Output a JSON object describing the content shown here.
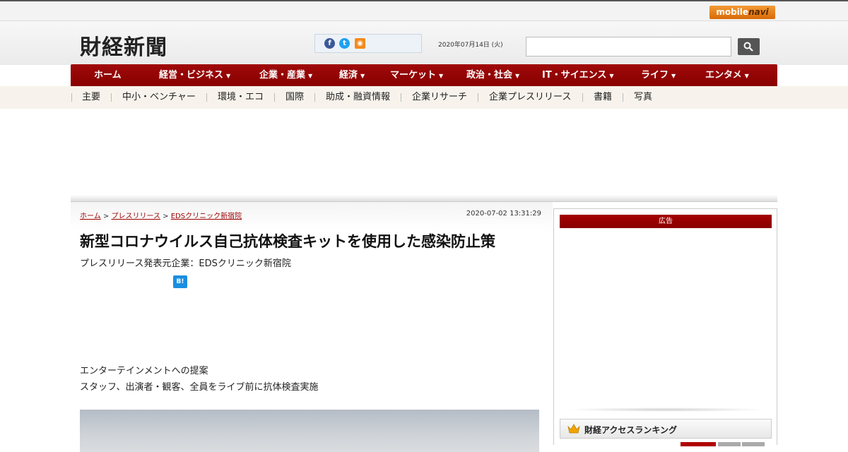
{
  "topbar": {
    "mobilenavi_m": "mobile",
    "mobilenavi_n": "navi"
  },
  "header": {
    "logo": "財経新聞",
    "date": "2020年07月14日 (火)",
    "search_placeholder": ""
  },
  "main_nav": [
    {
      "label": "ホーム",
      "arrow": ""
    },
    {
      "label": "経営・ビジネス",
      "arrow": "▼"
    },
    {
      "label": "企業・産業",
      "arrow": "▼"
    },
    {
      "label": "経済",
      "arrow": "▼"
    },
    {
      "label": "マーケット",
      "arrow": "▼"
    },
    {
      "label": "政治・社会",
      "arrow": "▼"
    },
    {
      "label": "IT・サイエンス",
      "arrow": "▼"
    },
    {
      "label": "ライフ",
      "arrow": "▼"
    },
    {
      "label": "エンタメ",
      "arrow": "▼"
    }
  ],
  "sub_nav": [
    "主要",
    "中小・ベンチャー",
    "環境・エコ",
    "国際",
    "助成・融資情報",
    "企業リサーチ",
    "企業プレスリリース",
    "書籍",
    "写真"
  ],
  "article": {
    "breadcrumb": [
      {
        "label": "ホーム"
      },
      {
        "label": "プレスリリース"
      },
      {
        "label": "EDSクリニック新宿院"
      }
    ],
    "crumb_sep": ">",
    "timestamp": "2020-07-02 13:31:29",
    "title": "新型コロナウイルス自己抗体検査キットを使用した感染防止策",
    "publisher": "プレスリリース発表元企業：EDSクリニック新宿院",
    "hatena_label": "B!",
    "lead_line1": "エンターテインメントへの提案",
    "lead_line2": "スタッフ、出演者・観客、全員をライブ前に抗体検査実施"
  },
  "sidebar": {
    "ad_label": "広告",
    "ranking_title": "財経アクセスランキング"
  },
  "colors": {
    "brand_red": "#990000",
    "accent_orange": "#f38a1e"
  }
}
